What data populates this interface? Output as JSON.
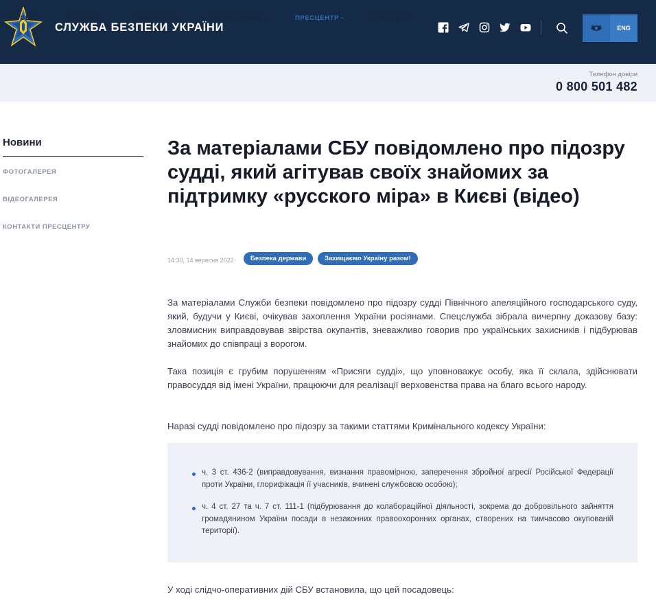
{
  "header": {
    "title": "СЛУЖБА БЕЗПЕКИ УКРАЇНИ",
    "socials": [
      "facebook-icon",
      "telegram-icon",
      "instagram-icon",
      "twitter-icon",
      "youtube-icon"
    ],
    "lang_label": "ENG"
  },
  "nav": {
    "items": [
      {
        "label": "ПРО СБУ",
        "active": false
      },
      {
        "label": "КАР'ЄРА",
        "active": false
      },
      {
        "label": "ДІЯЛЬНІСТЬ",
        "active": false
      },
      {
        "label": "ГРОМАДЯНАМ",
        "active": false
      },
      {
        "label": "ПРЕСЦЕНТР",
        "active": true
      },
      {
        "label": "КОНТАКТИ",
        "active": false
      }
    ],
    "phone_label": "Телефон довіри",
    "phone_number": "0 800 501 482"
  },
  "sidebar": {
    "title": "Новини",
    "items": [
      {
        "label": "ФОТОГАЛЕРЕЯ"
      },
      {
        "label": "ВІДЕОГАЛЕРЕЯ"
      },
      {
        "label": "КОНТАКТИ ПРЕСЦЕНТРУ"
      }
    ]
  },
  "article": {
    "title": "За матеріалами СБУ повідомлено про підозру судді, який агітував своїх знайомих за підтримку «русского міра» в Києві (відео)",
    "date": "14:30, 14 вересня 2022",
    "tags": [
      {
        "label": "Безпека держави"
      },
      {
        "label": "Захищаємо Україну разом!"
      }
    ],
    "paragraphs": [
      "За матеріалами Служби безпеки повідомлено про підозру судді Північного апеляційного господарського суду, який, будучи у Києві, очікував захоплення України росіянами. Спецслужба зібрала вичерпну доказову базу: зловмисник виправдовував звірства окупантів, зневажливо говорив про українських захисників і підбурював знайомих до співпраці з ворогом.",
      "Така позиція є грубим порушенням «Присяги судді», що уповноважує особу, яка її склала, здійснювати правосуддя від імені України, працюючи для реалізації верховенства права на благо всього народу.",
      "Наразі судді повідомлено про підозру за такими статтями Кримінального кодексу України:"
    ],
    "list": [
      "ч. 3 ст. 436-2 (виправдовування, визнання правомірною, заперечення збройної агресії Російської Федерації проти України, глорифікація її учасників, вчинені службовою особою);",
      "ч. 4 ст. 27 та ч. 7 ст. 111-1 (підбурювання до колабораційної діяльності, зокрема до добровільного зайняття громадянином України посади в незаконних правоохоронних органах, створених на тимчасово окупованій території)."
    ],
    "closing": "У ході слідчо-оперативних дій СБУ встановила, що цей посадовець:"
  },
  "colors": {
    "header_bg": "#152a47",
    "accent": "#2f6db8",
    "nav_bg": "#eef2f8"
  }
}
